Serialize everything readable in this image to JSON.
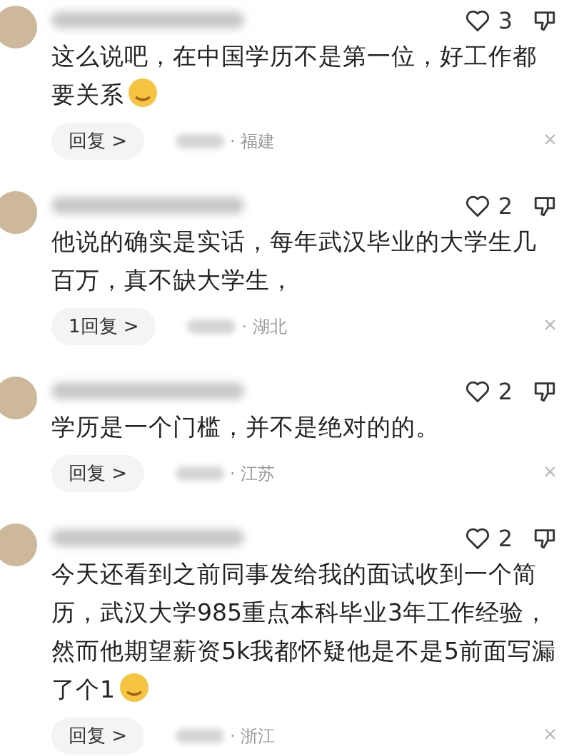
{
  "comments": [
    {
      "likes": "3",
      "text": "这么说吧，在中国学历不是第一位，好工作都要关系",
      "emoji": true,
      "reply_label": "回复",
      "reply_caret": ">",
      "location": "· 福建",
      "close": "×"
    },
    {
      "likes": "2",
      "text": "他说的确实是实话，每年武汉毕业的大学生几百万，真不缺大学生，",
      "emoji": false,
      "reply_label": "1回复",
      "reply_caret": ">",
      "location": "· 湖北",
      "close": "×"
    },
    {
      "likes": "2",
      "text": "学历是一个门槛，并不是绝对的的。",
      "emoji": false,
      "reply_label": "回复",
      "reply_caret": ">",
      "location": "· 江苏",
      "close": "×"
    },
    {
      "likes": "2",
      "text": "今天还看到之前同事发给我的面试收到一个简历，武汉大学985重点本科毕业3年工作经验，然而他期望薪资5k我都怀疑他是不是5前面写漏了个1",
      "emoji": true,
      "reply_label": "回复",
      "reply_caret": ">",
      "location": "· 浙江",
      "close": "×"
    }
  ]
}
